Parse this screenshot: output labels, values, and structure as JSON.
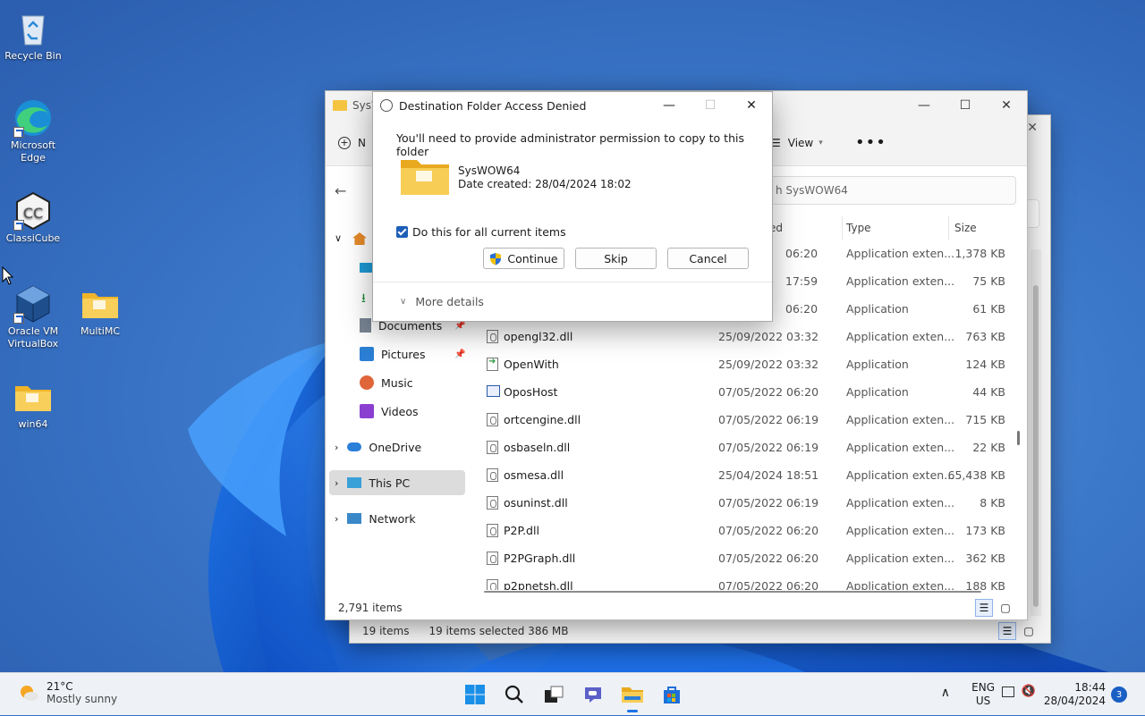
{
  "desktop": {
    "icons": [
      {
        "label": "Recycle Bin"
      },
      {
        "label": "Microsoft Edge"
      },
      {
        "label": "ClassiCube"
      },
      {
        "label": "Oracle VM VirtualBox"
      },
      {
        "label": "MultiMC"
      },
      {
        "label": "win64"
      }
    ]
  },
  "explorer": {
    "title": "SysW",
    "cmd_new_label": "N",
    "cmd_view_label": "View",
    "search_placeholder": "h SysWOW64",
    "nav": {
      "documents": "Documents",
      "pictures": "Pictures",
      "music": "Music",
      "videos": "Videos",
      "onedrive": "OneDrive",
      "this_pc": "This PC",
      "network": "Network"
    },
    "columns": {
      "date_partial": "ed",
      "type": "Type",
      "size": "Size"
    },
    "rows": [
      {
        "name": "",
        "date": "06:20",
        "type": "Application exten...",
        "size": "1,378 KB"
      },
      {
        "name": "",
        "date": "17:59",
        "type": "Application exten...",
        "size": "75 KB"
      },
      {
        "name": "",
        "date": "06:20",
        "type": "Application",
        "size": "61 KB"
      },
      {
        "name": "opengl32.dll",
        "date": "25/09/2022 03:32",
        "type": "Application exten...",
        "size": "763 KB"
      },
      {
        "name": "OpenWith",
        "date": "25/09/2022 03:32",
        "type": "Application",
        "size": "124 KB"
      },
      {
        "name": "OposHost",
        "date": "07/05/2022 06:20",
        "type": "Application",
        "size": "44 KB"
      },
      {
        "name": "ortcengine.dll",
        "date": "07/05/2022 06:19",
        "type": "Application exten...",
        "size": "715 KB"
      },
      {
        "name": "osbaseln.dll",
        "date": "07/05/2022 06:19",
        "type": "Application exten...",
        "size": "22 KB"
      },
      {
        "name": "osmesa.dll",
        "date": "25/04/2024 18:51",
        "type": "Application exten...",
        "size": "65,438 KB"
      },
      {
        "name": "osuninst.dll",
        "date": "07/05/2022 06:19",
        "type": "Application exten...",
        "size": "8 KB"
      },
      {
        "name": "P2P.dll",
        "date": "07/05/2022 06:20",
        "type": "Application exten...",
        "size": "173 KB"
      },
      {
        "name": "P2PGraph.dll",
        "date": "07/05/2022 06:20",
        "type": "Application exten...",
        "size": "362 KB"
      },
      {
        "name": "p2pnetsh.dll",
        "date": "07/05/2022 06:20",
        "type": "Application exten...",
        "size": "188 KB"
      }
    ],
    "status_items": "2,791 items"
  },
  "explorer_back": {
    "status_items": "19 items",
    "status_selected": "19 items selected  386 MB"
  },
  "dialog": {
    "title": "Destination Folder Access Denied",
    "message": "You'll need to provide administrator permission to copy to this folder",
    "folder_name": "SysWOW64",
    "folder_date": "Date created: 28/04/2024 18:02",
    "checkbox_label": "Do this for all current items",
    "checkbox_checked": true,
    "continue_label": "Continue",
    "skip_label": "Skip",
    "cancel_label": "Cancel",
    "more_details_label": "More details"
  },
  "taskbar": {
    "weather_temp": "21°C",
    "weather_cond": "Mostly sunny",
    "lang_top": "ENG",
    "lang_bottom": "US",
    "time": "18:44",
    "date": "28/04/2024",
    "notification_count": "3"
  },
  "colors": {
    "accent": "#1d5fb8",
    "folder": "#f5c542",
    "taskbar": "#eef1f6"
  }
}
